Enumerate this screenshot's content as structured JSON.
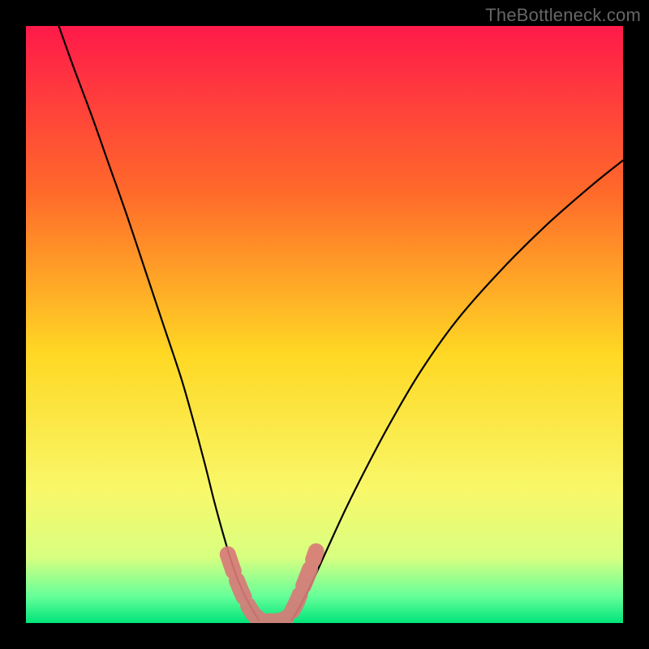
{
  "watermark": "TheBottleneck.com",
  "chart_data": {
    "type": "line",
    "title": "",
    "xlabel": "",
    "ylabel": "",
    "xlim": [
      0,
      100
    ],
    "ylim": [
      0,
      100
    ],
    "background_gradient": {
      "stops": [
        {
          "offset": 0,
          "color": "#ff1a4a"
        },
        {
          "offset": 0.28,
          "color": "#ff6a2a"
        },
        {
          "offset": 0.55,
          "color": "#ffd824"
        },
        {
          "offset": 0.78,
          "color": "#f8f86a"
        },
        {
          "offset": 0.89,
          "color": "#d8ff80"
        },
        {
          "offset": 0.955,
          "color": "#66ff99"
        },
        {
          "offset": 1.0,
          "color": "#00e47a"
        }
      ]
    },
    "series": [
      {
        "name": "left-curve",
        "stroke": "#000000",
        "x": [
          5.5,
          8,
          11,
          14,
          17,
          20,
          23,
          26,
          28,
          30,
          31.5,
          33,
          34.5,
          36,
          37.5,
          39
        ],
        "y": [
          100,
          93,
          85,
          76.5,
          68,
          59,
          50,
          41,
          34,
          26.5,
          20.5,
          15,
          10,
          6,
          3,
          0.5
        ]
      },
      {
        "name": "right-curve",
        "stroke": "#000000",
        "x": [
          44.5,
          46,
          48,
          50.5,
          53.5,
          57,
          61,
          66,
          72,
          79,
          87,
          95,
          100
        ],
        "y": [
          0.5,
          3,
          7,
          12.5,
          19,
          26,
          33.5,
          42,
          50.5,
          58.5,
          66.5,
          73.5,
          77.5
        ]
      },
      {
        "name": "marker-band",
        "stroke": "#d87a78",
        "type_hint": "thick-segment",
        "x": [
          33.8,
          35,
          36.2,
          37.3,
          38.2,
          39.2,
          40.5,
          42,
          43.2,
          44.3,
          45.3,
          46.3,
          47.4,
          48.6
        ],
        "y": [
          11.5,
          8.0,
          5.0,
          2.8,
          1.4,
          0.6,
          0.3,
          0.3,
          0.6,
          1.6,
          3.4,
          5.8,
          8.6,
          12.0
        ]
      }
    ]
  }
}
